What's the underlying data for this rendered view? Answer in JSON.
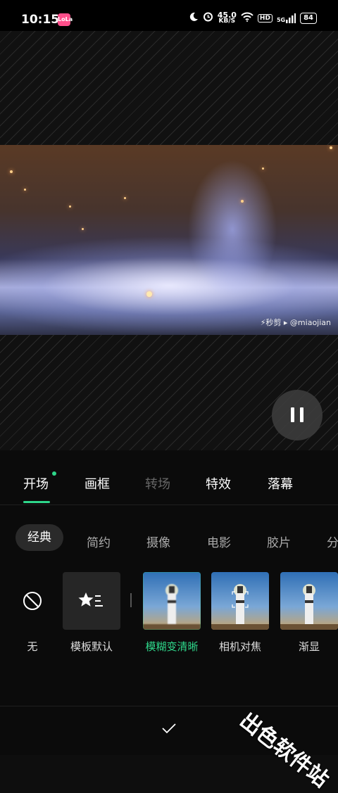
{
  "status_bar": {
    "time": "10:15",
    "app_badge": "LoLa",
    "net_speed": "45.0",
    "net_unit": "KB/S",
    "hd": "HD",
    "signal": "5G",
    "battery": "84"
  },
  "preview": {
    "watermark": "⚡秒剪 ▸ @miaojian"
  },
  "tabs": [
    {
      "label": "开场",
      "active": true
    },
    {
      "label": "画框"
    },
    {
      "label": "转场",
      "disabled": true
    },
    {
      "label": "特效"
    },
    {
      "label": "落幕"
    }
  ],
  "subtabs": [
    "经典",
    "简约",
    "摄像",
    "电影",
    "胶片",
    "分"
  ],
  "items": [
    {
      "label": "无",
      "icon": "none-icon"
    },
    {
      "label": "模板默认",
      "icon": "star-list-icon"
    },
    {
      "label": "模糊变清晰",
      "selected": true
    },
    {
      "label": "相机对焦"
    },
    {
      "label": "渐显"
    }
  ],
  "confirm_icon": "check-icon",
  "brand_watermark": "出色软件站",
  "colors": {
    "accent": "#2ed68a",
    "background": "#0b0b0b"
  }
}
